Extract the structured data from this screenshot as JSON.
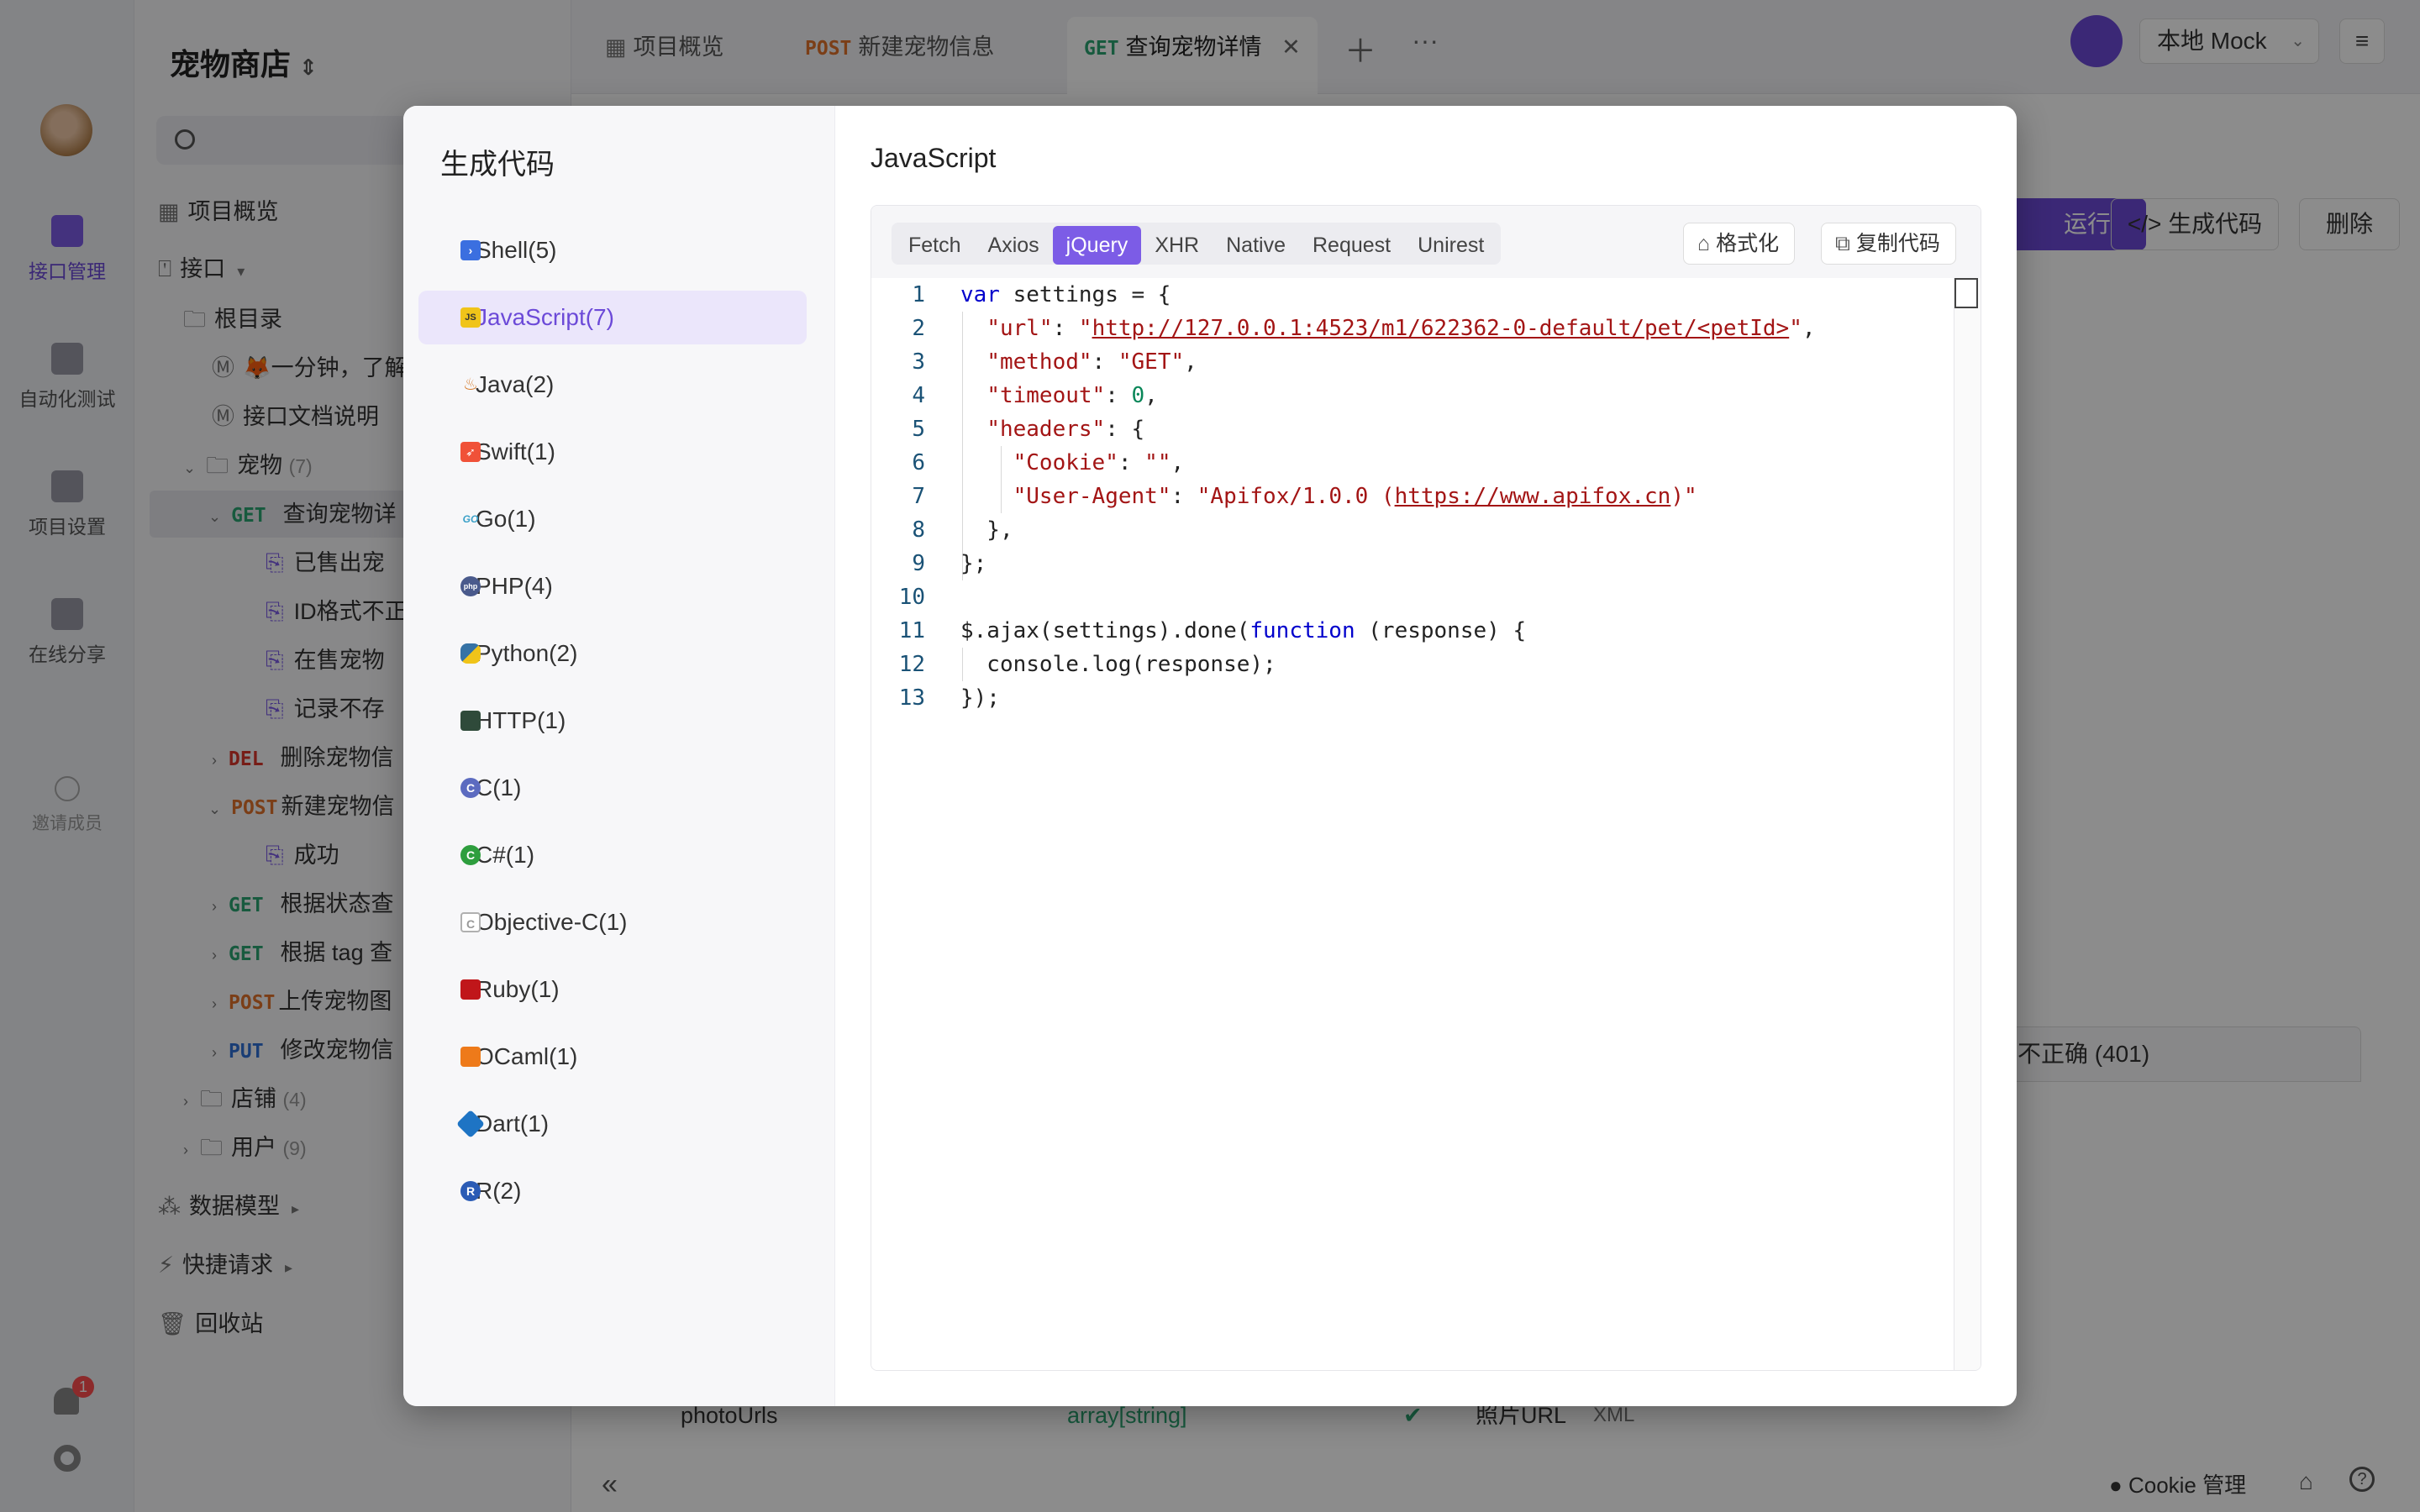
{
  "window": {
    "traffic_lights": [
      "#ff5f57",
      "#febc2e",
      "#28c840"
    ]
  },
  "rail": {
    "items": [
      {
        "label": "接口管理",
        "icon": "api-management-icon",
        "active": true
      },
      {
        "label": "自动化测试",
        "icon": "automation-test-icon"
      },
      {
        "label": "项目设置",
        "icon": "project-settings-icon"
      },
      {
        "label": "在线分享",
        "icon": "online-share-icon"
      },
      {
        "label": "邀请成员",
        "icon": "invite-member-icon"
      }
    ],
    "notification_count": "1"
  },
  "project": {
    "name": "宠物商店"
  },
  "tree": {
    "overview": "项目概览",
    "api_section": "接口",
    "root": "根目录",
    "docs": [
      "🦊一分钟，了解",
      "接口文档说明"
    ],
    "folder_pets": {
      "name": "宠物",
      "count": "(7)"
    },
    "items": [
      {
        "method": "GET",
        "label": "查询宠物详",
        "color": "#2ba471"
      },
      {
        "method": "",
        "label": "已售出宠"
      },
      {
        "method": "",
        "label": "ID格式不正"
      },
      {
        "method": "",
        "label": "在售宠物"
      },
      {
        "method": "",
        "label": "记录不存"
      },
      {
        "method": "DEL",
        "label": "删除宠物信",
        "color": "#d9362b"
      },
      {
        "method": "POST",
        "label": "新建宠物信",
        "color": "#e0712a"
      },
      {
        "method": "",
        "label": "成功"
      },
      {
        "method": "GET",
        "label": "根据状态查",
        "color": "#2ba471"
      },
      {
        "method": "GET",
        "label": "根据 tag 查",
        "color": "#2ba471"
      },
      {
        "method": "POST",
        "label": "上传宠物图",
        "color": "#e0712a"
      },
      {
        "method": "PUT",
        "label": "修改宠物信",
        "color": "#2f6fd6"
      }
    ],
    "folder_store": {
      "name": "店铺",
      "count": "(4)"
    },
    "folder_user": {
      "name": "用户",
      "count": "(9)"
    },
    "data_model": "数据模型",
    "quick_request": "快捷请求",
    "recycle": "回收站"
  },
  "tabs": [
    {
      "method": "",
      "label": "项目概览"
    },
    {
      "method": "POST",
      "label": "新建宠物信息"
    },
    {
      "method": "GET",
      "label": "查询宠物详情"
    }
  ],
  "env": {
    "label": "本地 Mock"
  },
  "main": {
    "run_label": "运行",
    "gen_code_label": "生成代码",
    "delete_label": "删除",
    "response_tab": "不正确 (401)",
    "field_name": "photoUrls",
    "field_type": "array[string]",
    "field_desc": "照片URL",
    "field_xml": "XML",
    "cookie_label": "Cookie 管理"
  },
  "modal": {
    "title": "生成代码",
    "languages": [
      {
        "label": "Shell(5)",
        "icon": "shell-icon",
        "color": "#3b6fe0"
      },
      {
        "label": "JavaScript(7)",
        "icon": "javascript-icon",
        "color": "#f0c419",
        "active": true
      },
      {
        "label": "Java(2)",
        "icon": "java-icon",
        "color": "#d67a2a"
      },
      {
        "label": "Swift(1)",
        "icon": "swift-icon",
        "color": "#f05138"
      },
      {
        "label": "Go(1)",
        "icon": "go-icon",
        "color": "#3aa0c8"
      },
      {
        "label": "PHP(4)",
        "icon": "php-icon",
        "color": "#4a5a8c"
      },
      {
        "label": "Python(2)",
        "icon": "python-icon",
        "color": "#3572a5"
      },
      {
        "label": "HTTP(1)",
        "icon": "http-icon",
        "color": "#2f4a3a"
      },
      {
        "label": "C(1)",
        "icon": "c-icon",
        "color": "#5c6bc0"
      },
      {
        "label": "C#(1)",
        "icon": "csharp-icon",
        "color": "#2e9e3e"
      },
      {
        "label": "Objective-C(1)",
        "icon": "objective-c-icon",
        "color": "#b0b0b0"
      },
      {
        "label": "Ruby(1)",
        "icon": "ruby-icon",
        "color": "#c0161a"
      },
      {
        "label": "OCaml(1)",
        "icon": "ocaml-icon",
        "color": "#ee7a1a"
      },
      {
        "label": "Dart(1)",
        "icon": "dart-icon",
        "color": "#1e74c4"
      },
      {
        "label": "R(2)",
        "icon": "r-icon",
        "color": "#2a5bb5"
      }
    ],
    "language_title": "JavaScript",
    "subtabs": [
      "Fetch",
      "Axios",
      "jQuery",
      "XHR",
      "Native",
      "Request",
      "Unirest"
    ],
    "active_subtab": "jQuery",
    "format_label": "格式化",
    "copy_label": "复制代码",
    "code_lines": [
      "var settings = {",
      "  \"url\": \"http://127.0.0.1:4523/m1/622362-0-default/pet/<petId>\",",
      "  \"method\": \"GET\",",
      "  \"timeout\": 0,",
      "  \"headers\": {",
      "    \"Cookie\": \"\",",
      "    \"User-Agent\": \"Apifox/1.0.0 (https://www.apifox.cn)\"",
      "  },",
      "};",
      "",
      "$.ajax(settings).done(function (response) {",
      "  console.log(response);",
      "});"
    ]
  }
}
